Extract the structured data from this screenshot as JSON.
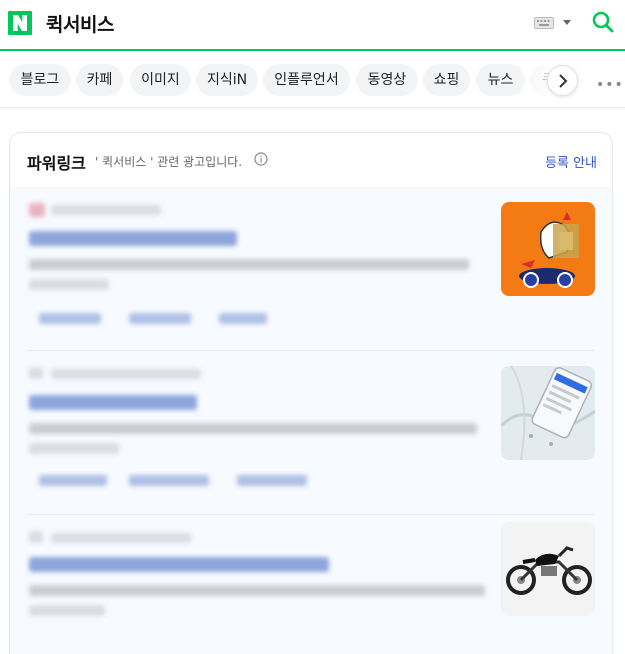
{
  "header": {
    "logo_letter": "N",
    "query": "퀵서비스",
    "brand_color": "#03c75a"
  },
  "tabs": [
    {
      "label": "블로그"
    },
    {
      "label": "카페"
    },
    {
      "label": "이미지"
    },
    {
      "label": "지식iN"
    },
    {
      "label": "인플루언서"
    },
    {
      "label": "동영상"
    },
    {
      "label": "쇼핑"
    },
    {
      "label": "뉴스"
    },
    {
      "label": "쿠"
    }
  ],
  "icons": {
    "keyboard": "keyboard-icon",
    "search": "search-icon",
    "scroll": "chevron-right-icon",
    "more": "more-icon",
    "info": "info-icon"
  },
  "powerlink": {
    "title": "파워링크",
    "description": "' 퀵서비스 ' 관련 광고입니다.",
    "register_label": "등록 안내",
    "link_color": "#2f54c5"
  },
  "ads": [
    {
      "thumbnail": "delivery-character-orange"
    },
    {
      "thumbnail": "map-phone-app"
    },
    {
      "thumbnail": "motorcycle"
    }
  ],
  "more_dots": "•••"
}
